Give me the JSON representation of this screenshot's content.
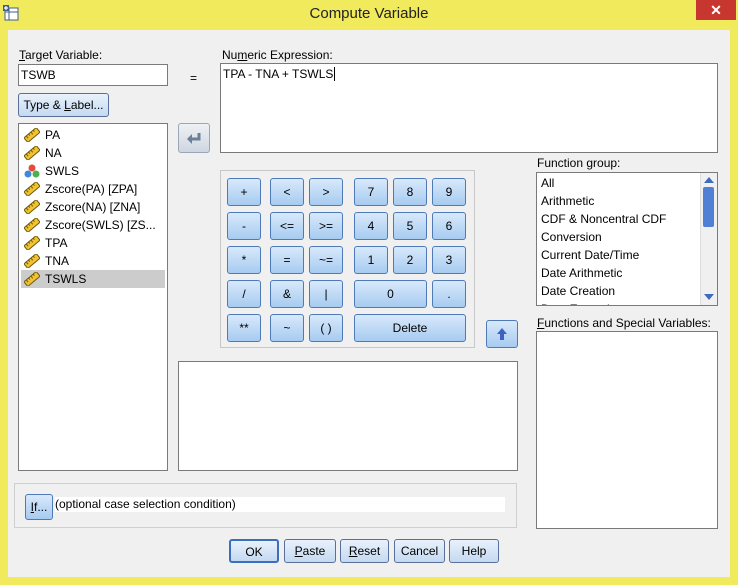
{
  "window": {
    "title": "Compute Variable",
    "close_glyph": "✕"
  },
  "target": {
    "label_prefix": "T",
    "label_rest": "arget Variable:",
    "value": "TSWB"
  },
  "equals": "=",
  "expression": {
    "label_prefix": "Nu",
    "label_u": "m",
    "label_rest": "eric Expression:",
    "value": "TPA - TNA + TSWLS"
  },
  "type_label_button": {
    "a": "Type & ",
    "u": "L",
    "b": "abel..."
  },
  "variables": [
    {
      "name": "PA",
      "icon": "scale-ruler-icon"
    },
    {
      "name": "NA",
      "icon": "scale-ruler-icon"
    },
    {
      "name": "SWLS",
      "icon": "nominal-circles-icon"
    },
    {
      "name": "Zscore(PA) [ZPA]",
      "icon": "scale-ruler-icon"
    },
    {
      "name": "Zscore(NA) [ZNA]",
      "icon": "scale-ruler-icon"
    },
    {
      "name": "Zscore(SWLS) [ZS...",
      "icon": "scale-ruler-icon"
    },
    {
      "name": "TPA",
      "icon": "scale-ruler-icon"
    },
    {
      "name": "TNA",
      "icon": "scale-ruler-icon"
    },
    {
      "name": "TSWLS",
      "icon": "scale-ruler-icon",
      "selected": true
    }
  ],
  "keypad": {
    "row1": [
      "+",
      "<",
      ">",
      "7",
      "8",
      "9"
    ],
    "row2": [
      "-",
      "<=",
      ">=",
      "4",
      "5",
      "6"
    ],
    "row3": [
      "*",
      "=",
      "~=",
      "1",
      "2",
      "3"
    ],
    "row4": [
      "/",
      "&",
      "|",
      "0",
      "."
    ],
    "row5": [
      "**",
      "~",
      "( )",
      "Delete"
    ]
  },
  "function_group": {
    "label": "Function group:",
    "items": [
      "All",
      "Arithmetic",
      "CDF & Noncentral CDF",
      "Conversion",
      "Current Date/Time",
      "Date Arithmetic",
      "Date Creation",
      "Date Extraction"
    ]
  },
  "functions_special": {
    "label_u": "F",
    "label_rest": "unctions and Special Variables:"
  },
  "if_row": {
    "btn_u": "I",
    "btn_rest": "f...",
    "text": "(optional case selection condition)"
  },
  "buttons": {
    "ok": "OK",
    "paste_u": "P",
    "paste_rest": "aste",
    "reset_u": "R",
    "reset_rest": "eset",
    "cancel": "Cancel",
    "help": "Help"
  }
}
